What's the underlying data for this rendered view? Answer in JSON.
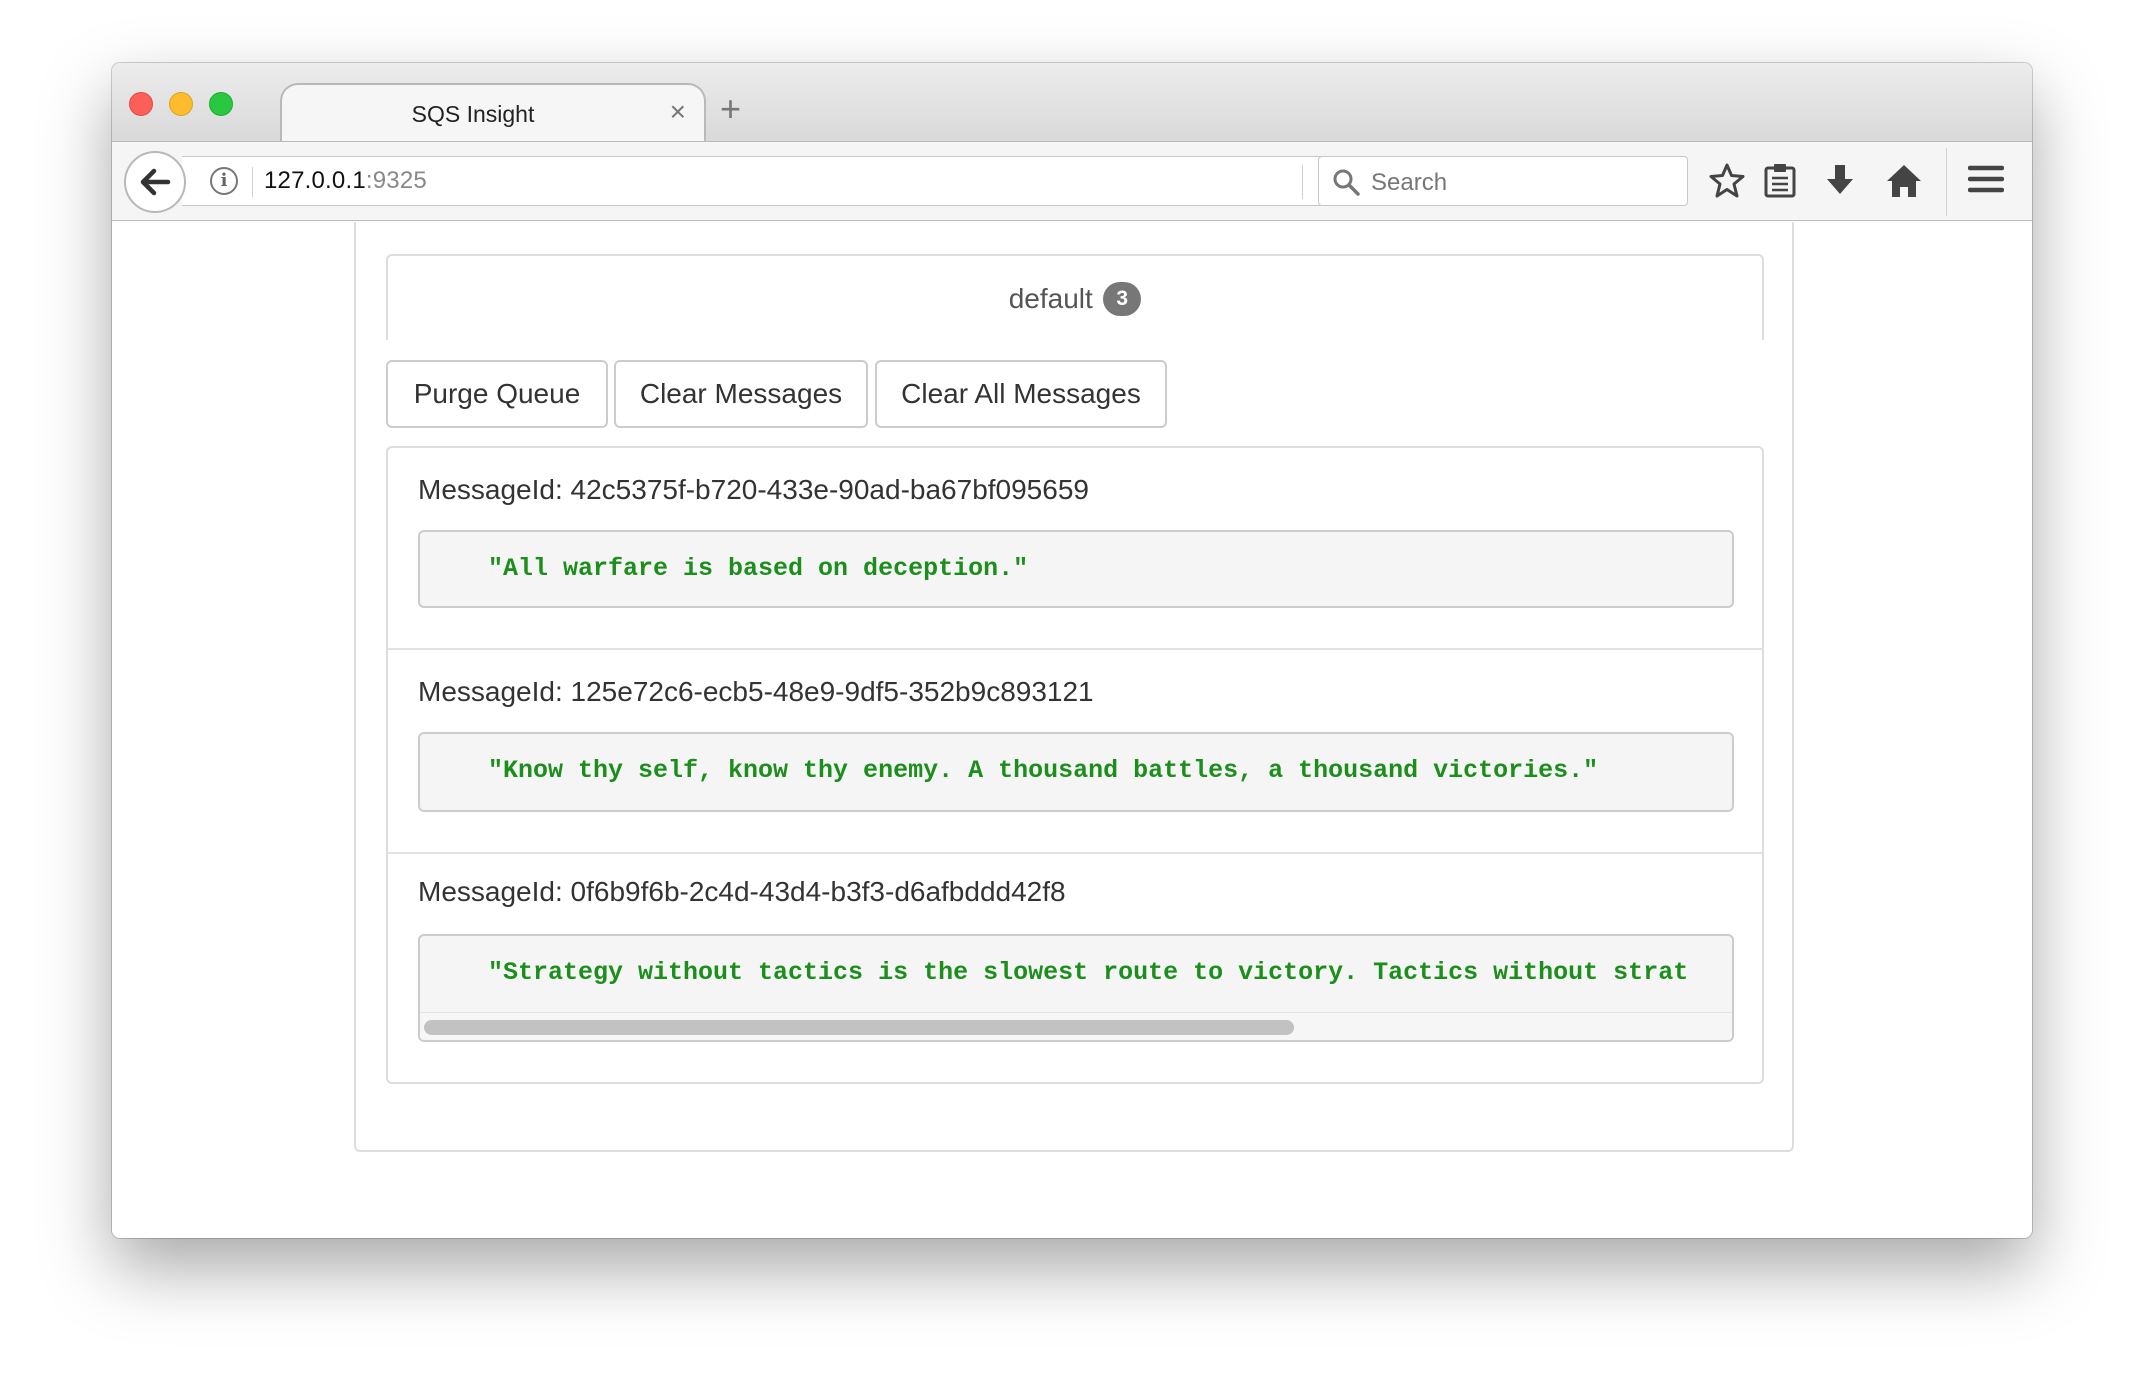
{
  "browser": {
    "tab_title": "SQS Insight",
    "tab_close": "×",
    "new_tab": "+",
    "url_host": "127.0.0.1",
    "url_port": ":9325",
    "search_placeholder": "Search"
  },
  "queue": {
    "name": "default",
    "count": "3"
  },
  "actions": {
    "purge_label": "Purge Queue",
    "clear_label": "Clear Messages",
    "clear_all_label": "Clear All Messages"
  },
  "messages": [
    {
      "id_label": "MessageId: 42c5375f-b720-433e-90ad-ba67bf095659",
      "body": "\"All warfare is based on deception.\""
    },
    {
      "id_label": "MessageId: 125e72c6-ecb5-48e9-9df5-352b9c893121",
      "body": "\"Know thy self, know thy enemy. A thousand battles, a thousand victories.\""
    },
    {
      "id_label": "MessageId: 0f6b9f6b-2c4d-43d4-b3f3-d6afbddd42f8",
      "body": "\"Strategy without tactics is the slowest route to victory. Tactics without strat"
    }
  ],
  "colors": {
    "code_text": "#1c8e1c",
    "badge_bg": "#777777",
    "traffic_close": "#fc5f57",
    "traffic_minimize": "#fdbc2e",
    "traffic_zoom": "#28c840"
  },
  "icons": {
    "back": "back-arrow-icon",
    "info": "info-icon",
    "reload": "reload-icon",
    "search": "search-icon",
    "bookmark": "star-icon",
    "reading_list": "clipboard-icon",
    "downloads": "download-icon",
    "home": "home-icon",
    "menu": "hamburger-menu-icon"
  }
}
